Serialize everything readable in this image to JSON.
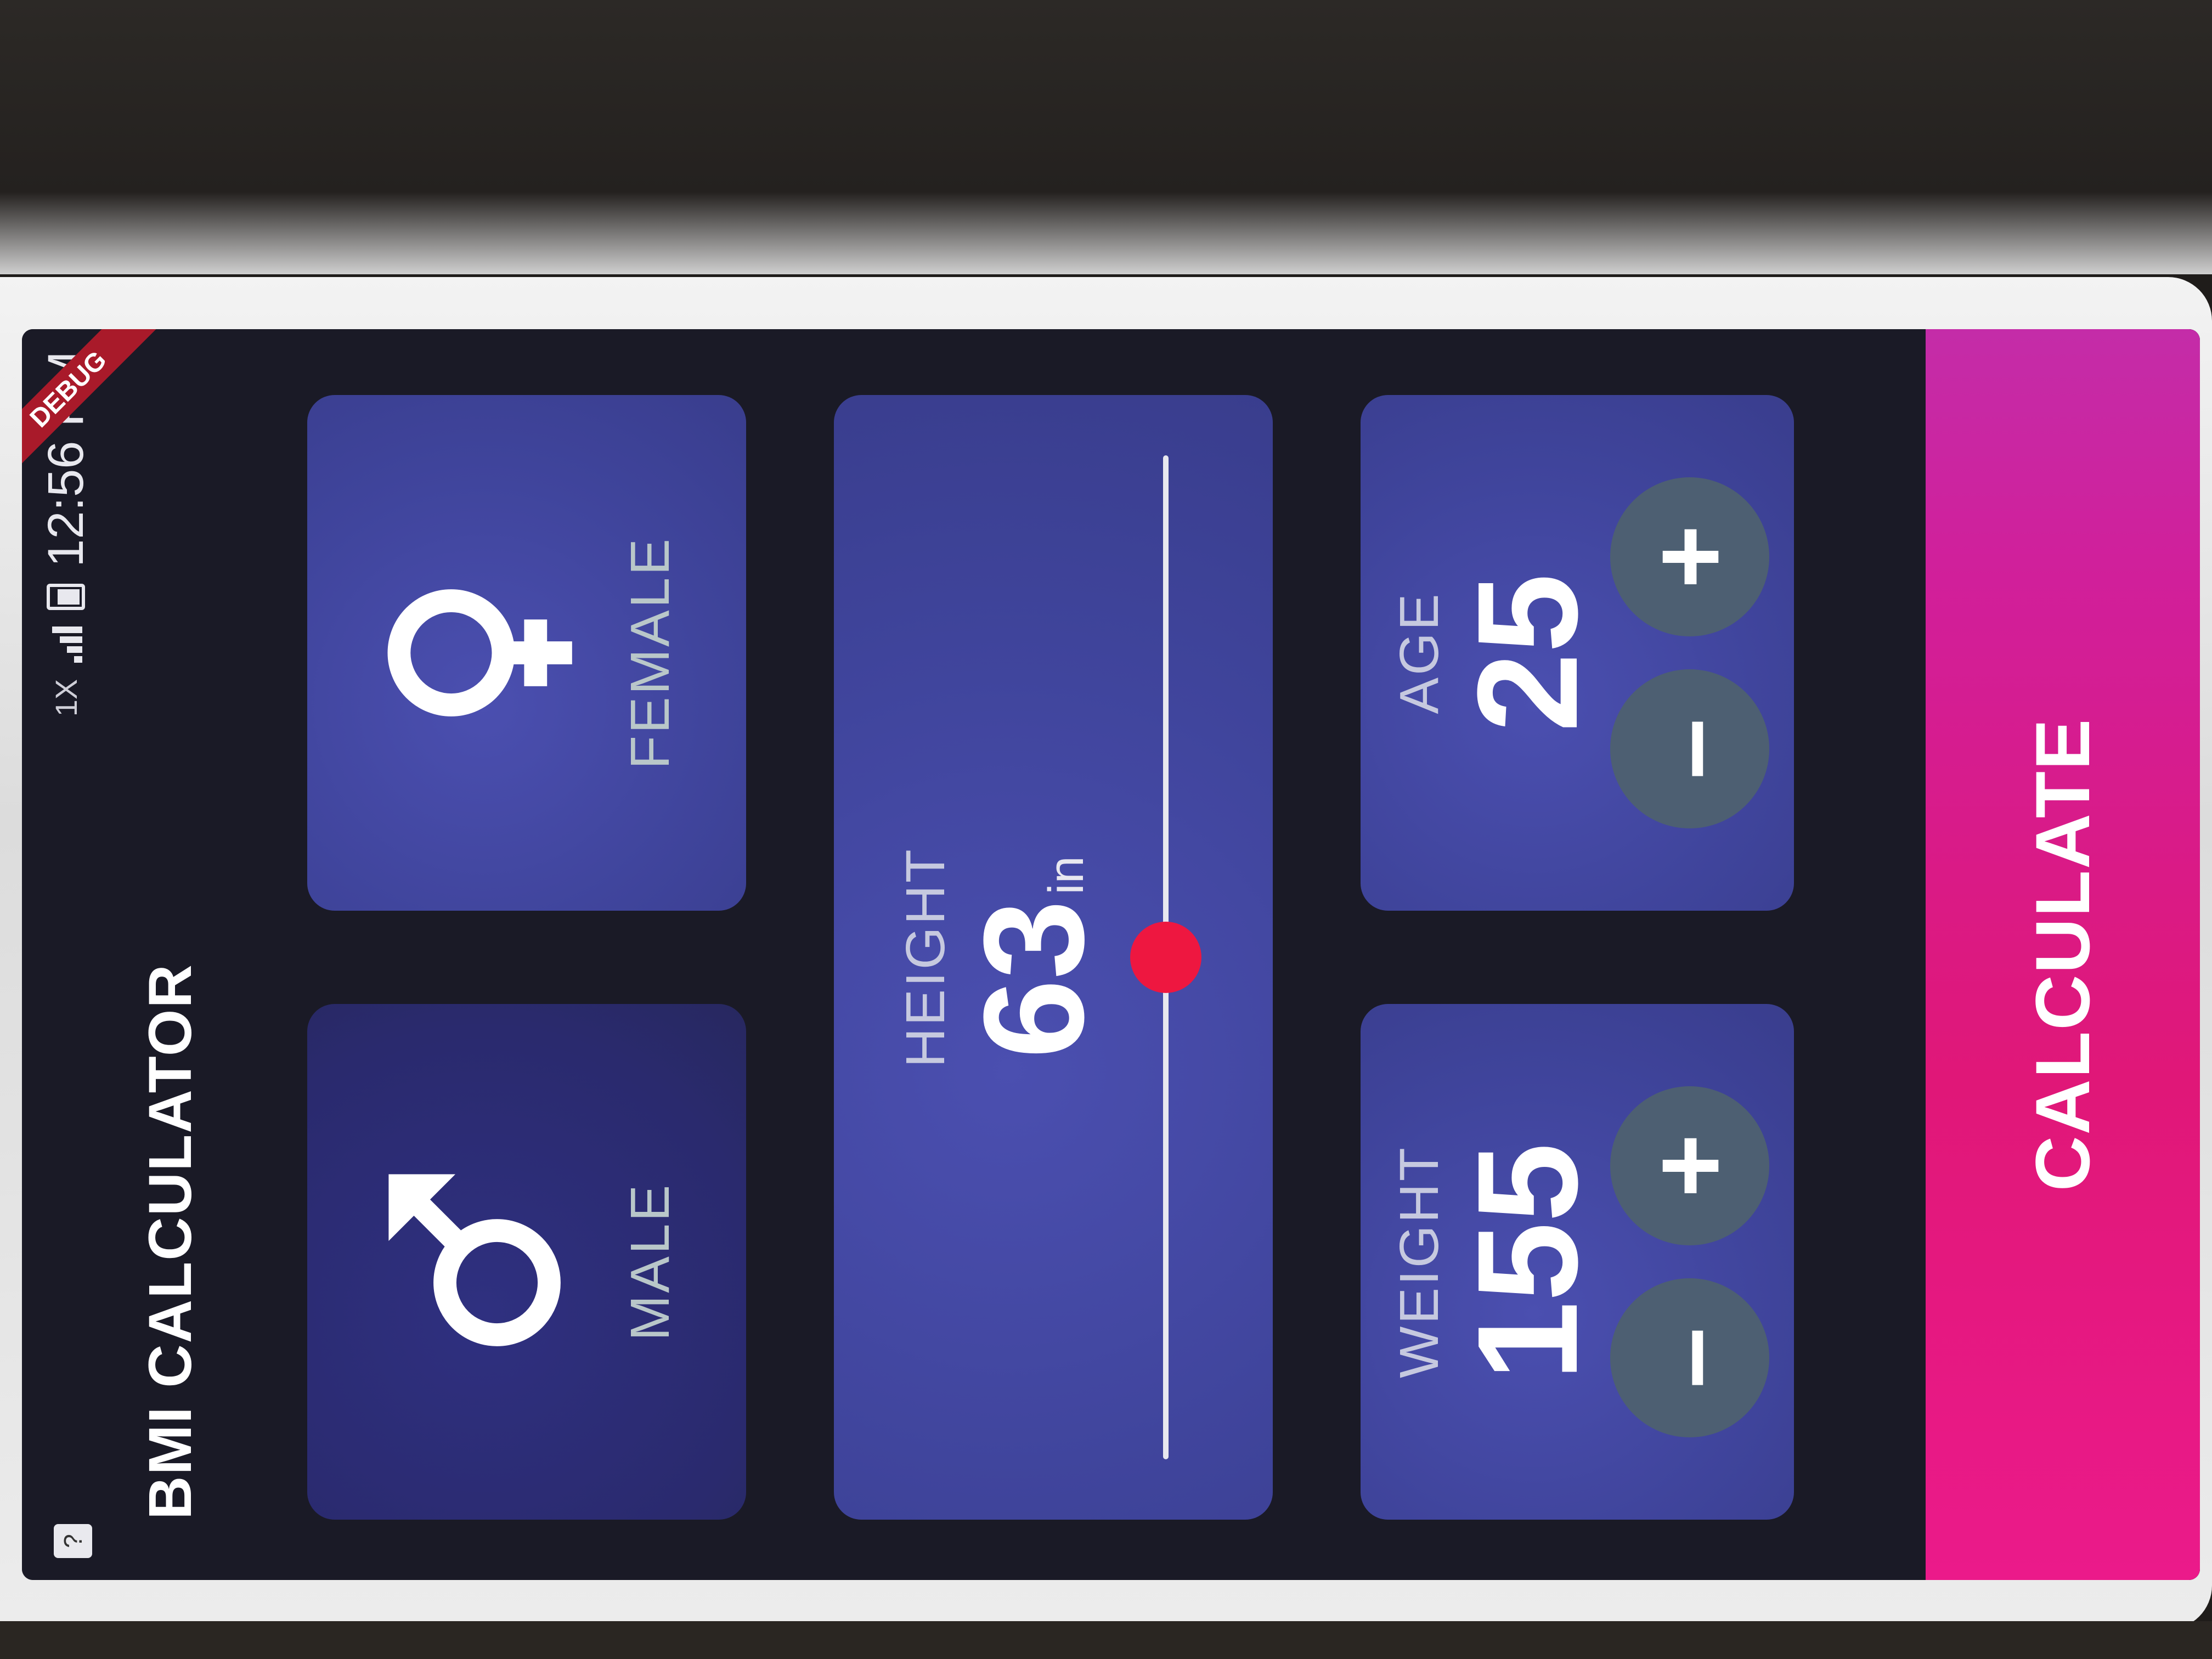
{
  "status_bar": {
    "time": "12:56 PM",
    "notification_icon": "unknown-app-icon",
    "network_badge": "1X",
    "debug_banner": "DEBUG"
  },
  "app_bar": {
    "title": "BMI CALCULATOR"
  },
  "gender": {
    "male_label": "MALE",
    "female_label": "FEMALE",
    "male_icon": "male-symbol-icon",
    "female_icon": "female-symbol-icon"
  },
  "height": {
    "label": "HEIGHT",
    "value": "63",
    "unit": "in"
  },
  "weight": {
    "label": "WEIGHT",
    "value": "155",
    "minus": "–",
    "plus": "+"
  },
  "age": {
    "label": "AGE",
    "value": "25",
    "minus": "–",
    "plus": "+"
  },
  "calculate": {
    "label": "CALCULATE"
  },
  "colors": {
    "background": "#1a1a26",
    "card_active": "#3f449b",
    "card_inactive": "#2a2a6e",
    "accent": "#eb1a8a",
    "slider_thumb": "#ee1740"
  }
}
